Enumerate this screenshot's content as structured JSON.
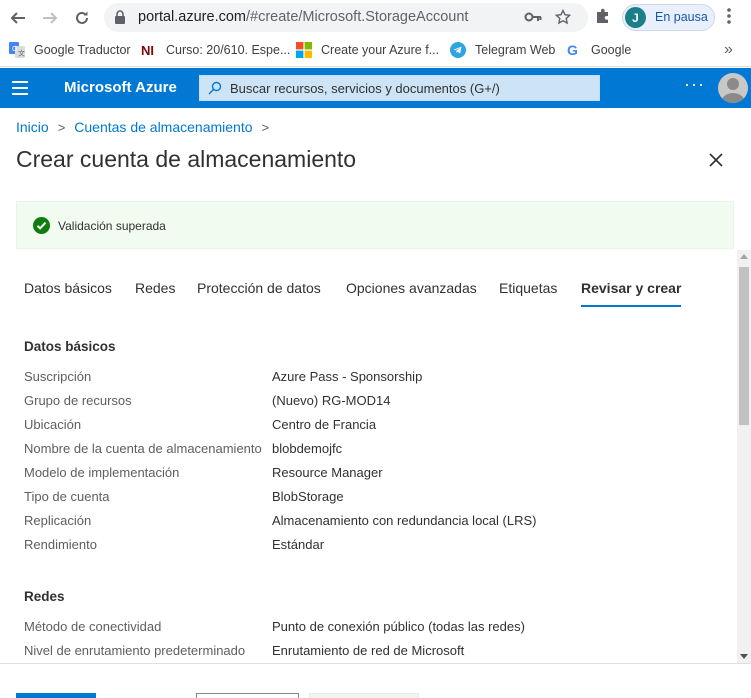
{
  "browser": {
    "url_host": "portal.azure.com",
    "url_path": "/#create/Microsoft.StorageAccount",
    "profile_initial": "J",
    "profile_status": "En pausa",
    "bookmarks": [
      {
        "label": "Google Traductor",
        "icon": "google-translate-icon"
      },
      {
        "label": "Curso: 20/610. Espe...",
        "icon": "ni-course-icon"
      },
      {
        "label": "Create your Azure f...",
        "icon": "microsoft-logo-icon"
      },
      {
        "label": "Telegram Web",
        "icon": "telegram-icon"
      },
      {
        "label": "Google",
        "icon": "google-icon"
      }
    ],
    "bookmarks_more": "»"
  },
  "azure": {
    "brand": "Microsoft Azure",
    "search_placeholder": "Buscar recursos, servicios y documentos (G+/)",
    "more_label": "···",
    "accent_color": "#0078d4"
  },
  "breadcrumb": {
    "items": [
      "Inicio",
      "Cuentas de almacenamiento"
    ],
    "separator": ">"
  },
  "page": {
    "title": "Crear cuenta de almacenamiento",
    "validation": "Validación superada"
  },
  "tabs": [
    {
      "label": "Datos básicos",
      "active": false
    },
    {
      "label": "Redes",
      "active": false
    },
    {
      "label": "Protección de datos",
      "active": false
    },
    {
      "label": "Opciones avanzadas",
      "active": false
    },
    {
      "label": "Etiquetas",
      "active": false
    },
    {
      "label": "Revisar y crear",
      "active": true
    }
  ],
  "sections": [
    {
      "title": "Datos básicos",
      "rows": [
        {
          "label": "Suscripción",
          "value": "Azure Pass - Sponsorship"
        },
        {
          "label": "Grupo de recursos",
          "value": "(Nuevo) RG-MOD14"
        },
        {
          "label": "Ubicación",
          "value": "Centro de Francia"
        },
        {
          "label": "Nombre de la cuenta de almacenamiento",
          "value": "blobdemojfc"
        },
        {
          "label": "Modelo de implementación",
          "value": "Resource Manager"
        },
        {
          "label": "Tipo de cuenta",
          "value": "BlobStorage"
        },
        {
          "label": "Replicación",
          "value": "Almacenamiento con redundancia local (LRS)"
        },
        {
          "label": "Rendimiento",
          "value": "Estándar"
        }
      ]
    },
    {
      "title": "Redes",
      "rows": [
        {
          "label": "Método de conectividad",
          "value": "Punto de conexión público (todas las redes)"
        },
        {
          "label": "Nivel de enrutamiento predeterminado",
          "value": "Enrutamiento de red de Microsoft"
        }
      ]
    }
  ]
}
